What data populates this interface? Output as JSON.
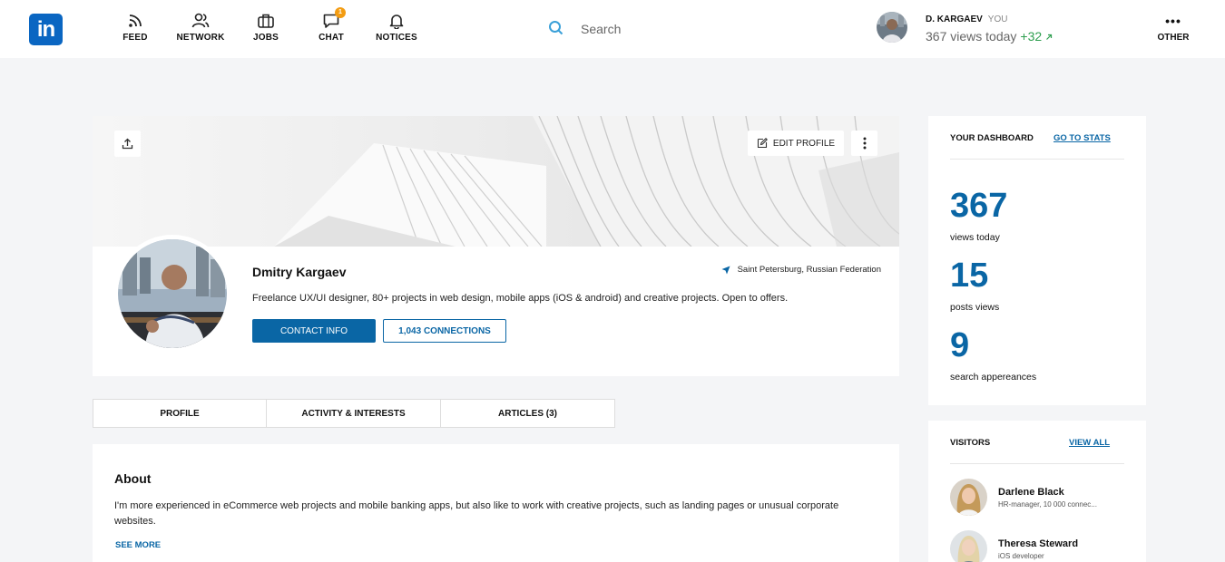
{
  "nav": {
    "logo": "in",
    "items": [
      {
        "label": "FEED",
        "icon": "rss-icon"
      },
      {
        "label": "NETWORK",
        "icon": "people-icon"
      },
      {
        "label": "JOBS",
        "icon": "briefcase-icon"
      },
      {
        "label": "CHAT",
        "icon": "chat-icon",
        "badge": "1"
      },
      {
        "label": "NOTICES",
        "icon": "bell-icon"
      }
    ],
    "search_placeholder": "Search",
    "user": {
      "name": "D. KARGAEV",
      "you_label": "YOU",
      "views": "367 views today",
      "delta": "+32"
    },
    "other_label": "OTHER"
  },
  "profile": {
    "edit_label": "EDIT PROFILE",
    "name": "Dmitry Kargaev",
    "location": "Saint Petersburg, Russian Federation",
    "headline": "Freelance UX/UI designer, 80+ projects in web design, mobile apps (iOS & android) and creative projects. Open to offers.",
    "contact_label": "CONTACT INFO",
    "connections_label": "1,043 CONNECTIONS"
  },
  "tabs": [
    "PROFILE",
    "ACTIVITY & INTERESTS",
    "ARTICLES (3)"
  ],
  "about": {
    "title": "About",
    "text": "I'm more experienced in eCommerce web projects and mobile banking apps, but also like to work with creative projects, such as landing pages or unusual corporate websites.",
    "see_more": "SEE MORE"
  },
  "dashboard": {
    "title": "YOUR DASHBOARD",
    "link": "GO TO STATS",
    "stats": [
      {
        "value": "367",
        "label": "views today"
      },
      {
        "value": "15",
        "label": "posts views"
      },
      {
        "value": "9",
        "label": "search appereances"
      }
    ]
  },
  "visitors": {
    "title": "VISITORS",
    "link": "VIEW ALL",
    "list": [
      {
        "name": "Darlene Black",
        "role": "HR-manager, 10 000 connec..."
      },
      {
        "name": "Theresa Steward",
        "role": "iOS developer"
      }
    ]
  },
  "colors": {
    "brand": "#0a66c2",
    "accent": "#0a66a5",
    "positive": "#2e9e4f",
    "badge": "#f39c12"
  }
}
